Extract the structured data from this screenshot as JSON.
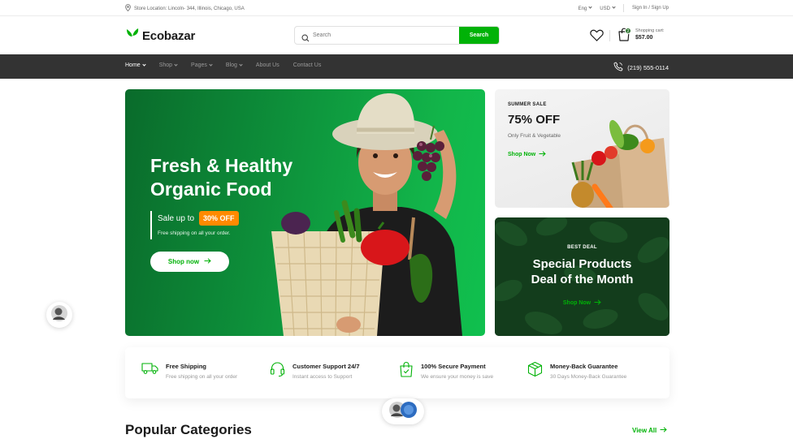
{
  "topbar": {
    "location": "Store Location: Lincoln- 344, Illinois, Chicago, USA",
    "language": "Eng",
    "currency": "USD",
    "sign_in": "Sign In",
    "slash": "/",
    "sign_up": "Sign Up"
  },
  "header": {
    "logo": "Ecobazar",
    "search_placeholder": "Search",
    "search_button": "Search",
    "cart_count": "2",
    "cart_label": "Shopping cart:",
    "cart_total": "$57.00"
  },
  "nav": {
    "items": [
      {
        "label": "Home"
      },
      {
        "label": "Shop"
      },
      {
        "label": "Pages"
      },
      {
        "label": "Blog"
      },
      {
        "label": "About Us"
      },
      {
        "label": "Contact Us"
      }
    ],
    "phone": "(219) 555-0114"
  },
  "hero": {
    "title_line1": "Fresh & Healthy",
    "title_line2": "Organic Food",
    "sale_label": "Sale up to",
    "sale_badge": "30% OFF",
    "shipping": "Free shipping on all your order.",
    "button": "Shop now"
  },
  "summer": {
    "tag": "SUMMER SALE",
    "headline": "75% OFF",
    "subtitle": "Only Fruit & Vegetable",
    "link": "Shop Now"
  },
  "deal": {
    "tag": "BEST DEAL",
    "title_line1": "Special Products",
    "title_line2": "Deal of the Month",
    "link": "Shop Now"
  },
  "features": [
    {
      "title": "Free Shipping",
      "subtitle": "Free shipping on all your order",
      "icon": "truck-icon"
    },
    {
      "title": "Customer Support 24/7",
      "subtitle": "Instant access to Support",
      "icon": "headphones-icon"
    },
    {
      "title": "100% Secure Payment",
      "subtitle": "We ensure your money is save",
      "icon": "shopping-bag-check-icon"
    },
    {
      "title": "Money-Back Guarantee",
      "subtitle": "30 Days Money-Back Guarantee",
      "icon": "package-icon"
    }
  ],
  "categories": {
    "title": "Popular Categories",
    "view_all": "View All"
  },
  "colors": {
    "brand_green": "#00b207",
    "dark_green": "#2c742f",
    "nav_bg": "#333333",
    "sale_orange": "#ff8a00"
  }
}
